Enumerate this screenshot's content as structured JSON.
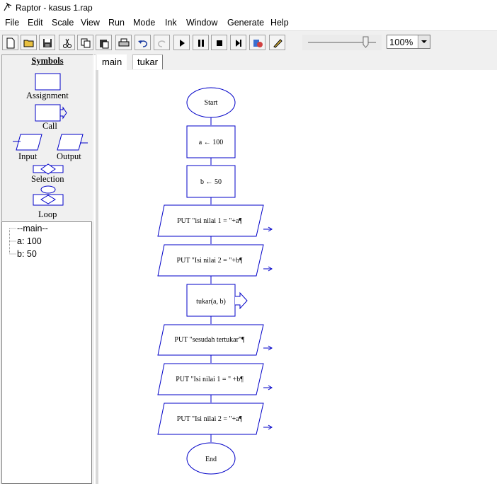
{
  "window": {
    "title": "Raptor - kasus 1.rap"
  },
  "menu": [
    "File",
    "Edit",
    "Scale",
    "View",
    "Run",
    "Mode",
    "Ink",
    "Window",
    "Generate",
    "Help"
  ],
  "toolbar": {
    "icons": [
      "new-file-icon",
      "open-folder-icon",
      "save-icon",
      "cut-icon",
      "copy-icon",
      "paste-icon",
      "print-icon",
      "undo-icon",
      "redo-icon",
      "run-icon",
      "pause-icon",
      "stop-icon",
      "step-icon",
      "test-server-icon",
      "pen-icon"
    ],
    "zoom_value": "100%",
    "speed_level_pct": 85
  },
  "symbols": {
    "title": "Symbols",
    "assignment": "Assignment",
    "call": "Call",
    "input": "Input",
    "output": "Output",
    "selection": "Selection",
    "loop": "Loop"
  },
  "variables": [
    "--main--",
    "a: 100",
    "b: 50"
  ],
  "tabs": [
    "main",
    "tukar"
  ],
  "flowchart": {
    "start": "Start",
    "steps": [
      {
        "type": "assignment",
        "text": "a ← 100"
      },
      {
        "type": "assignment",
        "text": "b ← 50"
      },
      {
        "type": "output",
        "text": "PUT \"isi nilai 1 = \"+a¶"
      },
      {
        "type": "output",
        "text": "PUT \"Isi nilai 2 = \"+b¶"
      },
      {
        "type": "call",
        "text": "tukar(a, b)"
      },
      {
        "type": "output",
        "text": "PUT \"sesudah tertukar\"¶"
      },
      {
        "type": "output",
        "text": "PUT \"Isi nilai 1 = \" +b¶"
      },
      {
        "type": "output",
        "text": "PUT \"Isi nilai 2 = \"+a¶"
      }
    ],
    "end": "End"
  }
}
